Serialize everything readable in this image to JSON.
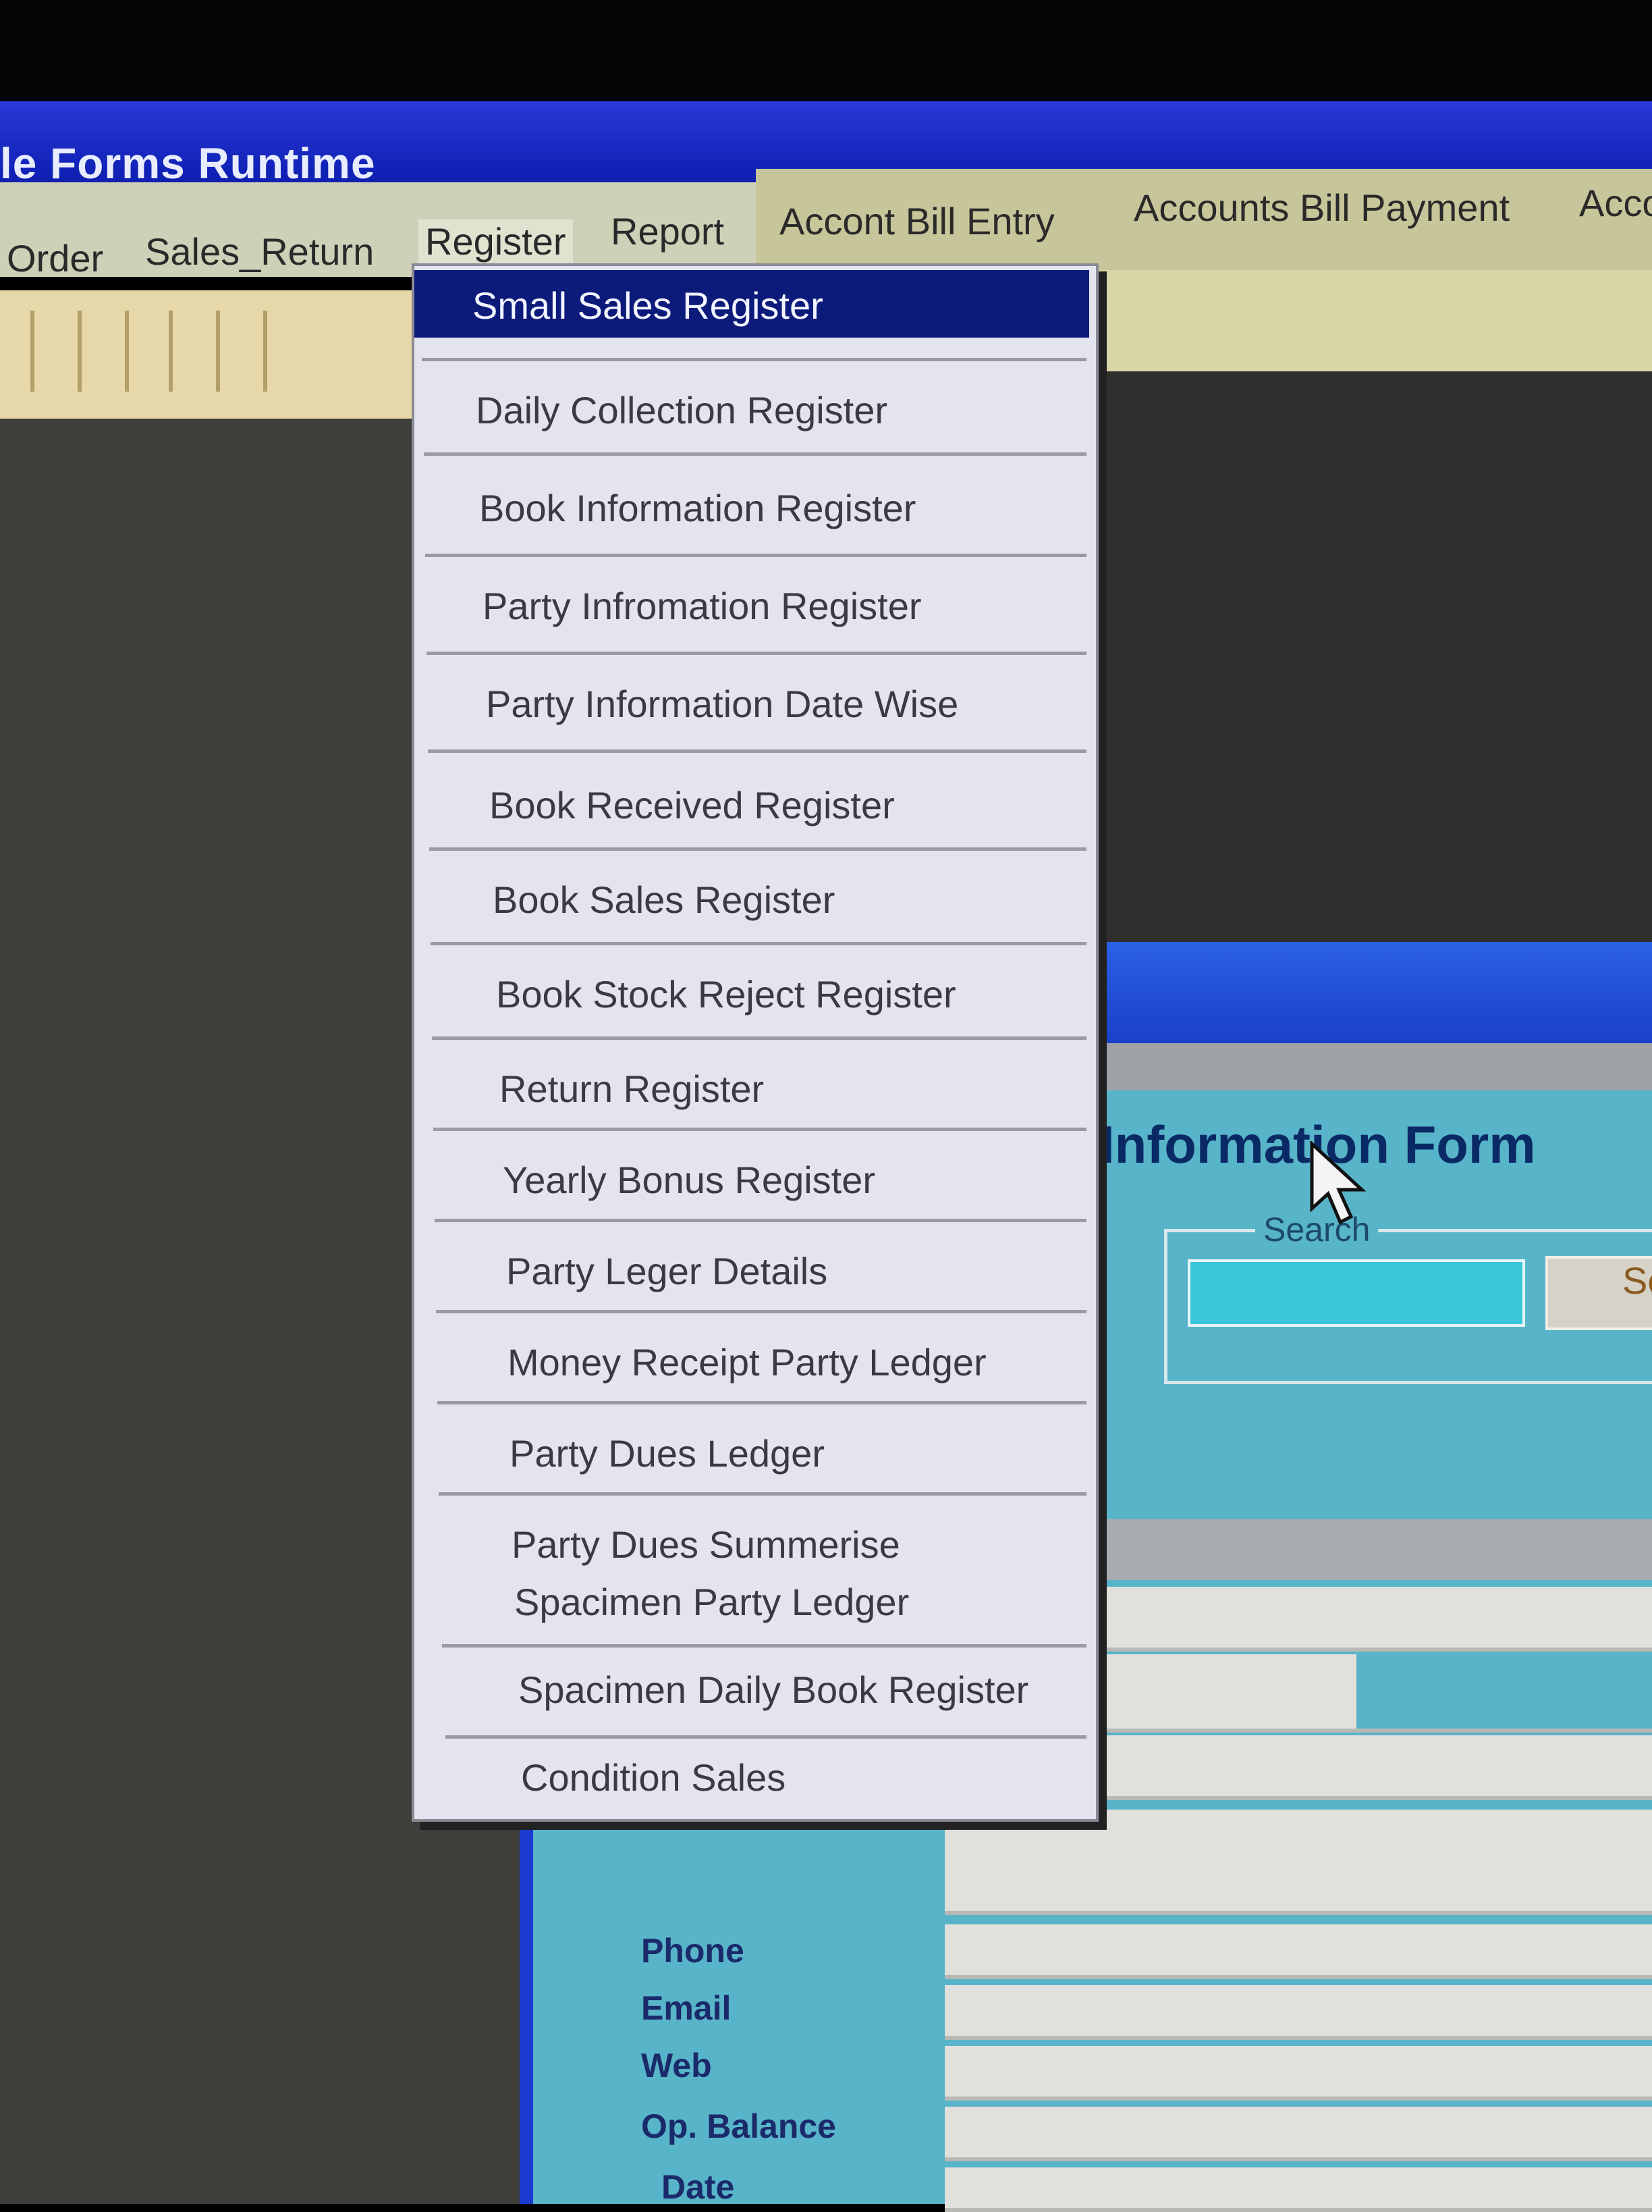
{
  "window": {
    "title": "le Forms Runtime"
  },
  "menubar": {
    "items": [
      {
        "label": "Order"
      },
      {
        "label": "Sales_Return"
      },
      {
        "label": "Register"
      },
      {
        "label": "Report"
      },
      {
        "label": "Accont  Bill Entry"
      },
      {
        "label": "Accounts Bill Payment"
      },
      {
        "label": "Acco"
      }
    ]
  },
  "dropdown": {
    "items": [
      {
        "label": "Small Sales Register",
        "selected": true
      },
      {
        "label": "Daily Collection Register"
      },
      {
        "label": "Book Information Register"
      },
      {
        "label": "Party Infromation Register"
      },
      {
        "label": "Party Information Date Wise"
      },
      {
        "label": "Book Received Register"
      },
      {
        "label": "Book Sales Register"
      },
      {
        "label": "Book Stock Reject Register"
      },
      {
        "label": "Return Register"
      },
      {
        "label": "Yearly Bonus Register"
      },
      {
        "label": "Party Leger Details"
      },
      {
        "label": "Money Receipt Party Ledger"
      },
      {
        "label": "Party Dues Ledger"
      },
      {
        "label": "Party Dues Summerise"
      },
      {
        "label": "Spacimen Party Ledger"
      },
      {
        "label": "Spacimen Daily Book Register"
      },
      {
        "label": "Condition Sales"
      }
    ]
  },
  "form": {
    "heading": "Information Form",
    "search_legend": "Search",
    "search_value": "",
    "search_button": "Se",
    "labels": {
      "phone": "Phone",
      "email": "Email",
      "web": "Web",
      "op_balance": "Op. Balance",
      "date": "Date"
    }
  },
  "colors": {
    "titlebar": "#1123b8",
    "menu_highlight": "#0c1a7a",
    "form_background": "#58b4c8"
  }
}
